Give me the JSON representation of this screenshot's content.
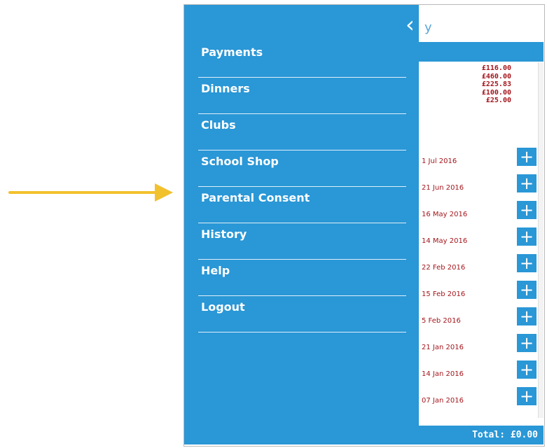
{
  "drawer": {
    "back_icon": "chevron-left-icon",
    "back_glyph": "‹",
    "items": [
      {
        "label": "Payments"
      },
      {
        "label": "Dinners"
      },
      {
        "label": "Clubs"
      },
      {
        "label": "School Shop"
      },
      {
        "label": "Parental Consent"
      },
      {
        "label": "History"
      },
      {
        "label": "Help"
      },
      {
        "label": "Logout"
      }
    ]
  },
  "background_app": {
    "search_glyph": "y",
    "amounts": [
      "£116.00",
      "£460.00",
      "£225.83",
      "£100.00",
      "£25.00"
    ],
    "dates": [
      "1 Jul 2016",
      "21 Jun 2016",
      "16 May 2016",
      "14 May 2016",
      "22 Feb 2016",
      "15 Feb 2016",
      "5 Feb 2016",
      "21 Jan 2016",
      "14 Jan 2016",
      "07 Jan 2016"
    ],
    "plus_glyph": "+",
    "total_label": "Total: £0.00"
  },
  "colors": {
    "drawer_bg": "#2a97d6",
    "amount_text": "#a4161c",
    "annotation_arrow": "#f2c12e"
  }
}
